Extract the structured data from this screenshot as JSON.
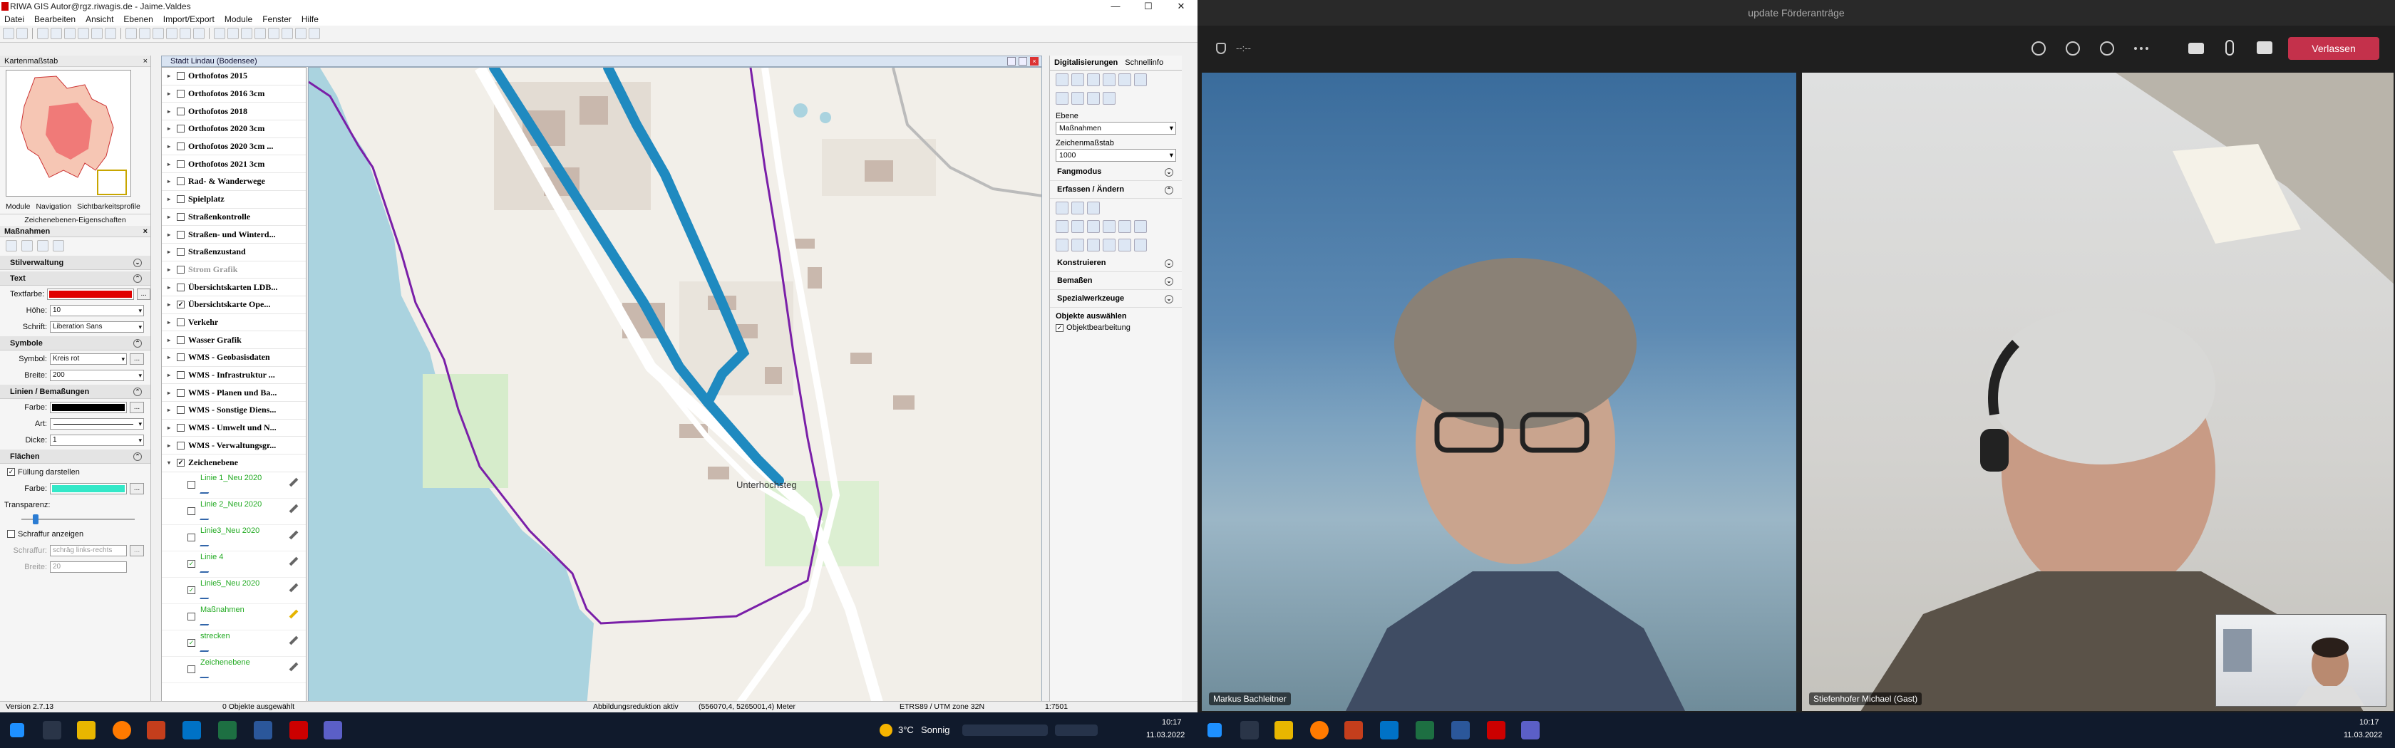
{
  "gis": {
    "window_title": "RIWA GIS Autor@rgz.riwagis.de - Jaime.Valdes",
    "win_controls": [
      "—",
      "☐",
      "✕"
    ],
    "menu": [
      "Datei",
      "Bearbeiten",
      "Ansicht",
      "Ebenen",
      "Import/Export",
      "Module",
      "Fenster",
      "Hilfe"
    ],
    "left_panel": {
      "header": "Kartenmaßstab",
      "tabs": [
        "Module",
        "Navigation",
        "Sichtbarkeitsprofile"
      ],
      "subheader": "Zeichenebenen-Eigenschaften",
      "massnahmen": "Maßnahmen",
      "sections": {
        "stil": "Stilverwaltung",
        "text": "Text",
        "symbole": "Symbole",
        "linien": "Linien / Bemaßungen",
        "flaechen": "Flächen"
      },
      "fields": {
        "textfarbe_label": "Textfarbe:",
        "hoehe_label": "Höhe:",
        "hoehe_value": "10",
        "schrift_label": "Schrift:",
        "schrift_value": "Liberation Sans",
        "symbol_label": "Symbol:",
        "symbol_value": "Kreis rot",
        "breite_label": "Breite:",
        "breite_value": "200",
        "farbe_label": "Farbe:",
        "art_label": "Art:",
        "dicke_label": "Dicke:",
        "dicke_value": "1",
        "fuellung_label": "Füllung darstellen",
        "flaeche_farbe_label": "Farbe:",
        "transparenz_label": "Transparenz:",
        "schraffur_anzeigen": "Schraffur anzeigen",
        "schraffur_label": "Schraffur:",
        "schraffur_value": "schräg links-rechts",
        "breite2_label": "Breite:",
        "breite2_value": "20"
      },
      "colors": {
        "text": "#e00000",
        "line": "#000000",
        "fill": "#33e8c8"
      }
    },
    "map_window_title": "Stadt Lindau (Bodensee)",
    "layers": [
      {
        "name": "Orthofotos 2015",
        "grey": false
      },
      {
        "name": "Orthofotos 2016 3cm",
        "grey": false
      },
      {
        "name": "Orthofotos 2018",
        "grey": false
      },
      {
        "name": "Orthofotos 2020 3cm",
        "grey": false
      },
      {
        "name": "Orthofotos 2020 3cm ...",
        "grey": false
      },
      {
        "name": "Orthofotos 2021 3cm",
        "grey": false
      },
      {
        "name": "Rad- & Wanderwege",
        "grey": false
      },
      {
        "name": "Spielplatz",
        "grey": false
      },
      {
        "name": "Straßenkontrolle",
        "grey": false
      },
      {
        "name": "Straßen- und Winterd...",
        "grey": false
      },
      {
        "name": "Straßenzustand",
        "grey": false
      },
      {
        "name": "Strom Grafik",
        "grey": true
      },
      {
        "name": "Übersichtskarten LDB...",
        "grey": false
      },
      {
        "name": "Übersichtskarte Ope...",
        "grey": false
      },
      {
        "name": "Verkehr",
        "grey": false
      },
      {
        "name": "Wasser Grafik",
        "grey": false
      },
      {
        "name": "WMS - Geobasisdaten",
        "grey": false
      },
      {
        "name": "WMS - Infrastruktur ...",
        "grey": false
      },
      {
        "name": "WMS - Planen und Ba...",
        "grey": false
      },
      {
        "name": "WMS - Sonstige Diens...",
        "grey": false
      },
      {
        "name": "WMS - Umwelt und N...",
        "grey": false
      },
      {
        "name": "WMS - Verwaltungsgr...",
        "grey": false
      },
      {
        "name": "Zeichenebene",
        "grey": false
      }
    ],
    "sublayers": [
      {
        "name": "Linie 1_Neu 2020",
        "checked": false
      },
      {
        "name": "Linie 2_Neu 2020",
        "checked": false
      },
      {
        "name": "Linie3_Neu 2020",
        "checked": false
      },
      {
        "name": "Linie 4",
        "checked": true
      },
      {
        "name": "Linie5_Neu 2020",
        "checked": true
      },
      {
        "name": "Maßnahmen",
        "checked": false
      },
      {
        "name": "strecken",
        "checked": true
      },
      {
        "name": "Zeichenebene",
        "checked": false
      }
    ],
    "map_label": "Unterhochsteg",
    "right_panel": {
      "tabs": [
        "Digitalisierungen",
        "Schnellinfo"
      ],
      "ebene_label": "Ebene",
      "ebene_value": "Maßnahmen",
      "massstab_label": "Zeichenmaßstab",
      "massstab_value": "1000",
      "sections": [
        "Fangmodus",
        "Erfassen / Ändern",
        "Konstruieren",
        "Bemaßen",
        "Spezialwerkzeuge"
      ],
      "objekte": "Objekte auswählen",
      "objektbearbeitung": "Objektbearbeitung"
    },
    "status": {
      "version": "Version 2.7.13",
      "selected": "0 Objekte ausgewählt",
      "reduktion": "Abbildungsreduktion aktiv",
      "coords": "(556070,4, 5265001,4) Meter",
      "crs": "ETRS89 / UTM zone 32N",
      "scale": "1:7501"
    }
  },
  "taskbar_left": {
    "weather_temp": "3°C",
    "weather_text": "Sonnig",
    "time": "10:17",
    "date": "11.03.2022"
  },
  "taskbar_right": {
    "time": "10:17",
    "date": "11.03.2022"
  },
  "teams": {
    "title": "update Förderanträge",
    "timer": "--:--",
    "leave_label": "Verlassen",
    "participants": [
      {
        "name": "Markus Bachleitner"
      },
      {
        "name": "Stiefenhofer Michael (Gast)"
      }
    ]
  }
}
